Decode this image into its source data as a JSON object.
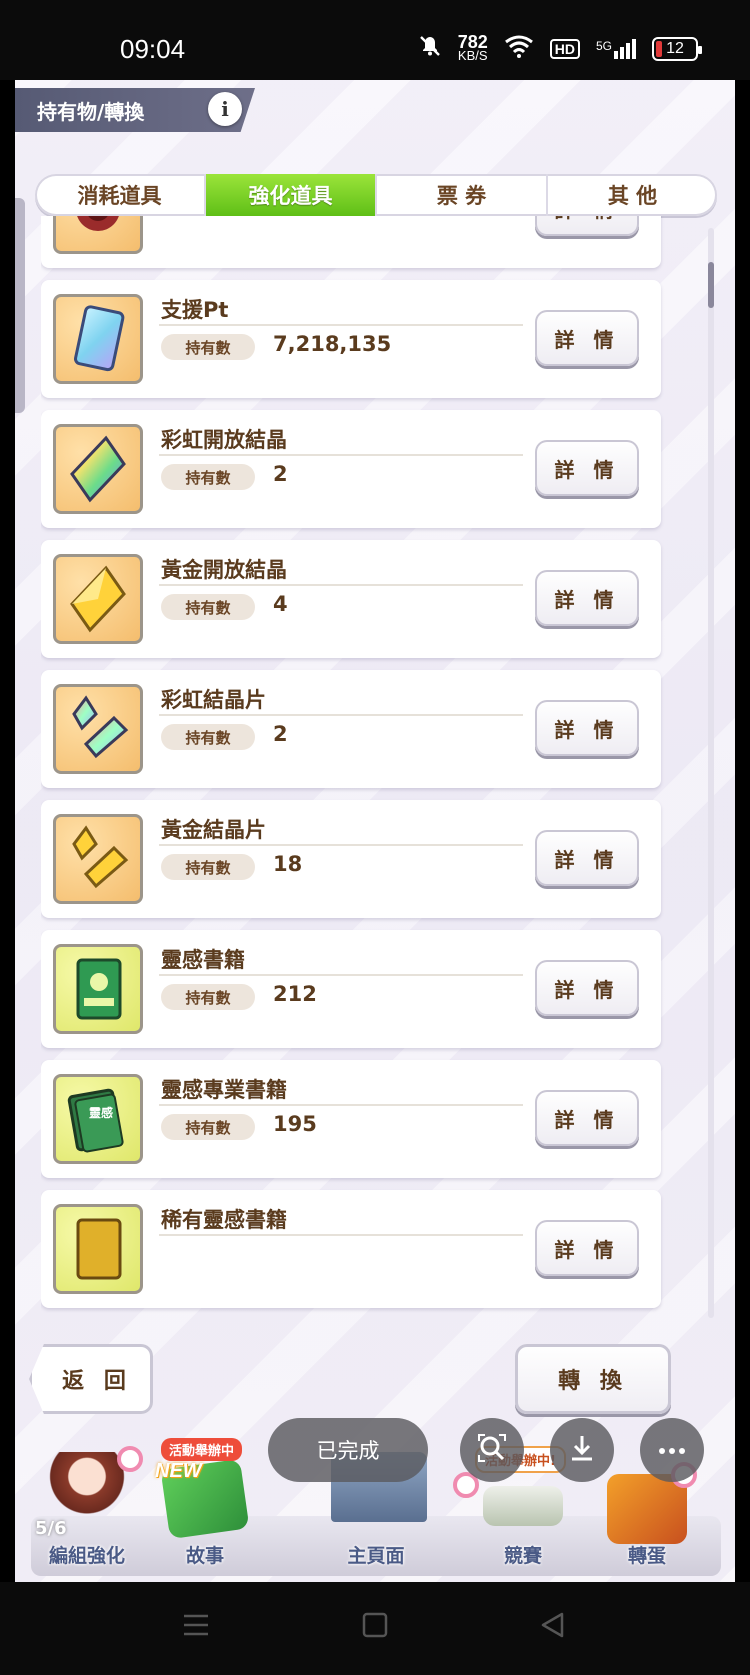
{
  "status_bar": {
    "time": "09:04",
    "net_speed_value": "782",
    "net_speed_unit": "KB/S",
    "hd_label": "HD",
    "signal_label": "5G",
    "battery": "12"
  },
  "header": {
    "title": "持有物/轉換",
    "info_glyph": "i"
  },
  "tabs": [
    {
      "label": "消耗道具",
      "active": false
    },
    {
      "label": "強化道具",
      "active": true
    },
    {
      "label": "票 券",
      "active": false
    },
    {
      "label": "其 他",
      "active": false
    }
  ],
  "held_label": "持有數",
  "detail_label": "詳 情",
  "items": [
    {
      "name": "",
      "count": ""
    },
    {
      "name": "支援Pt",
      "count": "7,218,135"
    },
    {
      "name": "彩虹開放結晶",
      "count": "2"
    },
    {
      "name": "黃金開放結晶",
      "count": "4"
    },
    {
      "name": "彩虹結晶片",
      "count": "2"
    },
    {
      "name": "黃金結晶片",
      "count": "18"
    },
    {
      "name": "靈感書籍",
      "count": "212"
    },
    {
      "name": "靈感專業書籍",
      "count": "195"
    },
    {
      "name": "稀有靈感書籍",
      "count": ""
    }
  ],
  "book_cover_text": "靈感",
  "buttons": {
    "back": "返 回",
    "convert": "轉 換"
  },
  "bottom_nav": [
    {
      "label": "編組強化"
    },
    {
      "label": "故事",
      "badge": "活動舉辦中",
      "new": "NEW"
    },
    {
      "label": "主頁面"
    },
    {
      "label": "競賽",
      "badge": "活動舉辦中!"
    },
    {
      "label": "轉蛋"
    }
  ],
  "overlay": {
    "pager": "5/6",
    "done": "已完成"
  },
  "colors": {
    "active_tab": "#6cc81f",
    "text_brown": "#5a3b1e",
    "nav_label": "#4a5a86",
    "badge_red": "#ee4d3a"
  }
}
